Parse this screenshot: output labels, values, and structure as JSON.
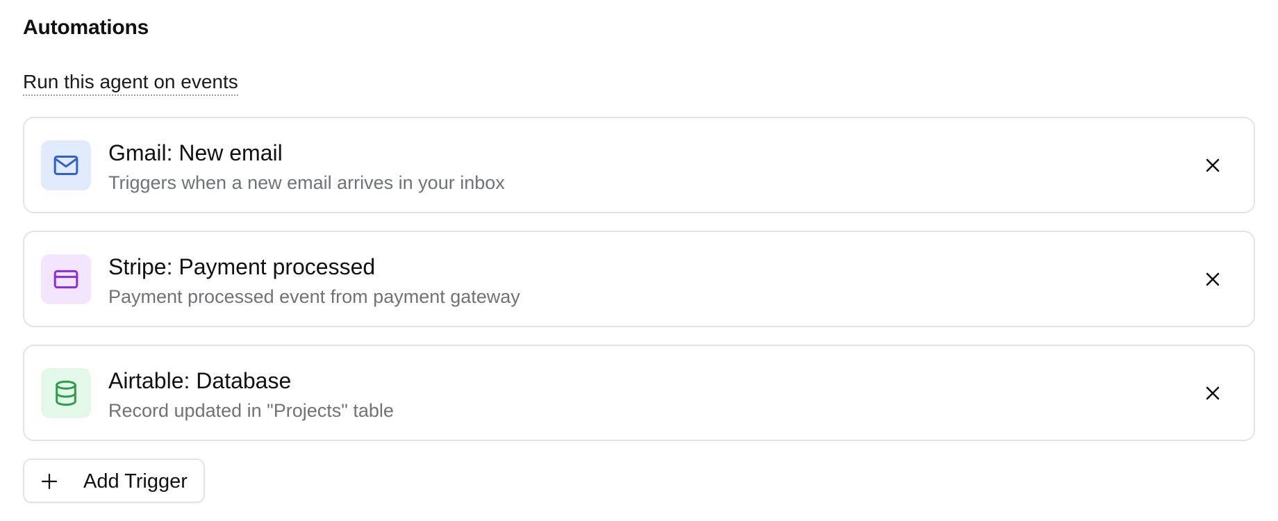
{
  "section": {
    "title": "Automations",
    "subtitle": "Run this agent on events"
  },
  "triggers": [
    {
      "title": "Gmail: New email",
      "description": "Triggers when a new email arrives in your inbox",
      "icon": "mail-icon",
      "icon_color": "#2b5fd9",
      "icon_bg": "#e1ebfd"
    },
    {
      "title": "Stripe: Payment processed",
      "description": "Payment processed event from payment gateway",
      "icon": "credit-card-icon",
      "icon_color": "#8a2be2",
      "icon_bg": "#f1e6fd"
    },
    {
      "title": "Airtable: Database",
      "description": "Record updated in \"Projects\" table",
      "icon": "database-icon",
      "icon_color": "#2f9e4a",
      "icon_bg": "#e3f8e8"
    }
  ],
  "add_trigger": {
    "label": "Add Trigger",
    "icon": "plus-icon"
  },
  "colors": {
    "card_border": "#e3e4e7",
    "description_text": "#6f7278"
  }
}
